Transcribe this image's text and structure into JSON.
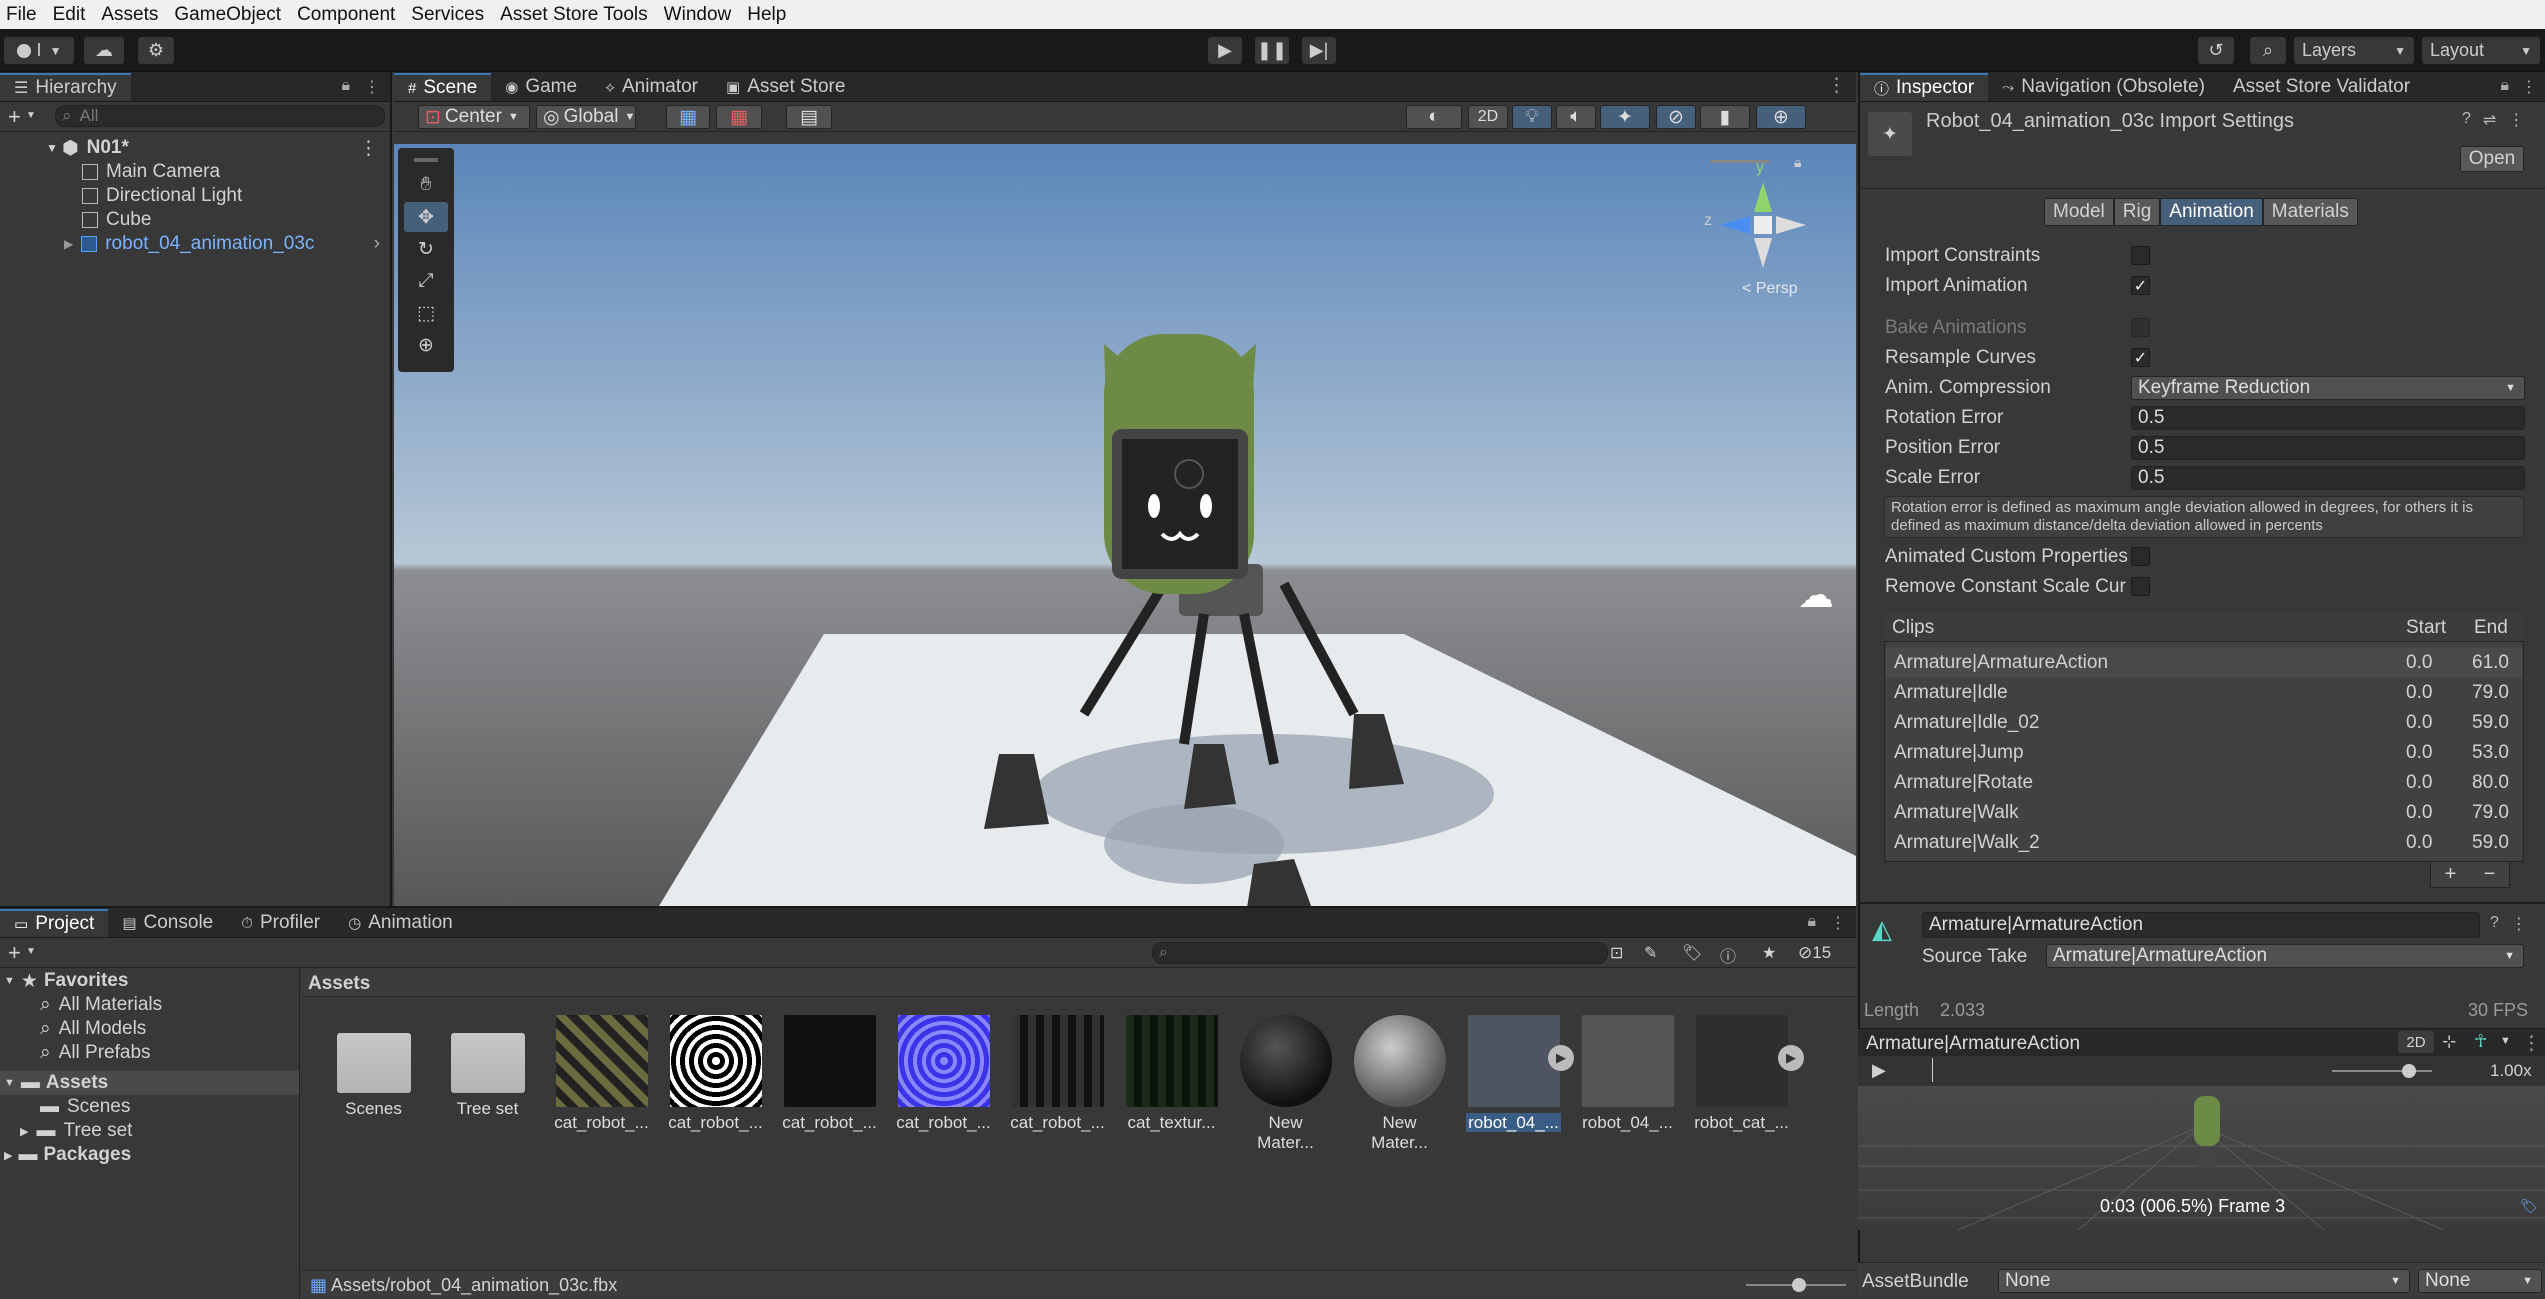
{
  "menu": [
    "File",
    "Edit",
    "Assets",
    "GameObject",
    "Component",
    "Services",
    "Asset Store Tools",
    "Window",
    "Help"
  ],
  "toolbar": {
    "layers_label": "Layers",
    "layout_label": "Layout",
    "account_label": "I"
  },
  "hierarchy": {
    "tab_label": "Hierarchy",
    "search_placeholder": "All",
    "scene_name": "N01*",
    "items": [
      "Main Camera",
      "Directional Light",
      "Cube",
      "robot_04_animation_03c"
    ]
  },
  "scene_tabs": [
    "Scene",
    "Game",
    "Animator",
    "Asset Store"
  ],
  "scene_toolbar": {
    "pivot": "Center",
    "space": "Global",
    "mode_2d": "2D"
  },
  "gizmo": {
    "y": "y",
    "z": "z",
    "persp": "< Persp"
  },
  "inspector": {
    "tabs": [
      "Inspector",
      "Navigation (Obsolete)",
      "Asset Store Validator"
    ],
    "title": "Robot_04_animation_03c Import Settings",
    "open_button": "Open",
    "subtabs": [
      "Model",
      "Rig",
      "Animation",
      "Materials"
    ],
    "rows": {
      "import_constraints": "Import Constraints",
      "import_animation": "Import Animation",
      "bake_animations": "Bake Animations",
      "resample_curves": "Resample Curves",
      "anim_compression": "Anim. Compression",
      "anim_compression_value": "Keyframe Reduction",
      "rotation_error": "Rotation Error",
      "rotation_error_value": "0.5",
      "position_error": "Position Error",
      "position_error_value": "0.5",
      "scale_error": "Scale Error",
      "scale_error_value": "0.5",
      "help_text": "Rotation error is defined as maximum angle deviation allowed in degrees, for others it is defined as maximum distance/delta deviation allowed in percents",
      "animated_custom_properties": "Animated Custom Properties",
      "remove_constant_scale": "Remove Constant Scale Cur"
    },
    "clips_header": {
      "clips": "Clips",
      "start": "Start",
      "end": "End"
    },
    "clips": [
      {
        "name": "Armature|ArmatureAction",
        "start": "0.0",
        "end": "61.0"
      },
      {
        "name": "Armature|Idle",
        "start": "0.0",
        "end": "79.0"
      },
      {
        "name": "Armature|Idle_02",
        "start": "0.0",
        "end": "59.0"
      },
      {
        "name": "Armature|Jump",
        "start": "0.0",
        "end": "53.0"
      },
      {
        "name": "Armature|Rotate",
        "start": "0.0",
        "end": "80.0"
      },
      {
        "name": "Armature|Walk",
        "start": "0.0",
        "end": "79.0"
      },
      {
        "name": "Armature|Walk_2",
        "start": "0.0",
        "end": "59.0"
      }
    ],
    "clip_name": "Armature|ArmatureAction",
    "source_take_label": "Source Take",
    "source_take_value": "Armature|ArmatureAction",
    "length_label": "Length",
    "length_value": "2.033",
    "fps": "30 FPS",
    "preview_title": "Armature|ArmatureAction",
    "preview_2d": "2D",
    "speed": "1.00x",
    "preview_time": "0:03 (006.5%) Frame 3",
    "assetbundle_label": "AssetBundle",
    "assetbundle_value": "None",
    "assetbundle_variant": "None"
  },
  "bottom_tabs": [
    "Project",
    "Console",
    "Profiler",
    "Animation"
  ],
  "project": {
    "favorites_label": "Favorites",
    "favorites": [
      "All Materials",
      "All Models",
      "All Prefabs"
    ],
    "assets_label": "Assets",
    "assets_children": [
      "Scenes",
      "Tree set"
    ],
    "packages_label": "Packages",
    "breadcrumb": "Assets",
    "hidden_count": "15",
    "path": "Assets/robot_04_animation_03c.fbx",
    "items": [
      "Scenes",
      "Tree set",
      "cat_robot_...",
      "cat_robot_...",
      "cat_robot_...",
      "cat_robot_...",
      "cat_robot_...",
      "cat_textur...",
      "New Mater...",
      "New Mater...",
      "robot_04_...",
      "robot_04_...",
      "robot_cat_..."
    ]
  }
}
